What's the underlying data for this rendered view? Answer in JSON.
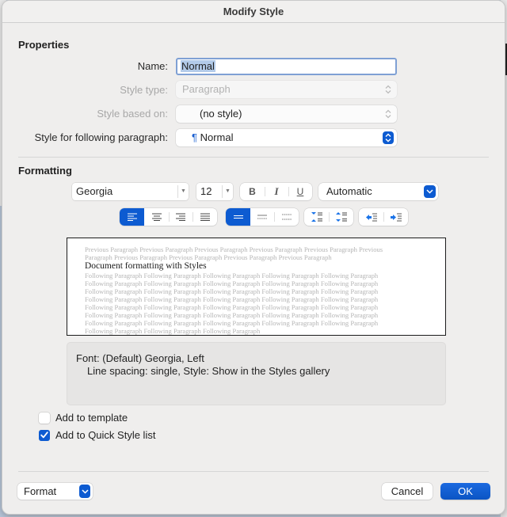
{
  "dialog": {
    "title": "Modify Style"
  },
  "properties": {
    "section_title": "Properties",
    "name_label": "Name:",
    "name_value": "Normal",
    "style_type_label": "Style type:",
    "style_type_value": "Paragraph",
    "based_on_label": "Style based on:",
    "based_on_value": "(no style)",
    "following_label": "Style for following paragraph:",
    "following_icon": "¶",
    "following_value": "Normal"
  },
  "formatting": {
    "section_title": "Formatting",
    "font_name": "Georgia",
    "font_size": "12",
    "bold_label": "B",
    "italic_label": "I",
    "underline_label": "U",
    "color_value": "Automatic",
    "alignment_buttons": [
      "align-left",
      "align-center",
      "align-right",
      "align-justify"
    ],
    "alignment_selected": "align-left",
    "spacing_buttons": [
      "single-spacing",
      "one-half-spacing",
      "double-spacing"
    ],
    "spacing_selected": "single-spacing",
    "paragraph_spacing_buttons": [
      "decrease-paragraph-spacing",
      "increase-paragraph-spacing"
    ],
    "indent_buttons": [
      "decrease-indent",
      "increase-indent"
    ]
  },
  "preview": {
    "previous_lines": [
      "Previous Paragraph Previous Paragraph Previous Paragraph Previous Paragraph Previous Paragraph Previous",
      "Paragraph Previous Paragraph Previous Paragraph Previous Paragraph Previous Paragraph"
    ],
    "sample_text": "Document formatting with Styles",
    "following_lines": [
      "Following Paragraph Following Paragraph Following Paragraph Following Paragraph Following Paragraph",
      "Following Paragraph Following Paragraph Following Paragraph Following Paragraph Following Paragraph",
      "Following Paragraph Following Paragraph Following Paragraph Following Paragraph Following Paragraph",
      "Following Paragraph Following Paragraph Following Paragraph Following Paragraph Following Paragraph",
      "Following Paragraph Following Paragraph Following Paragraph Following Paragraph Following Paragraph",
      "Following Paragraph Following Paragraph Following Paragraph Following Paragraph Following Paragraph",
      "Following Paragraph Following Paragraph Following Paragraph Following Paragraph Following Paragraph",
      "Following Paragraph Following Paragraph Following Paragraph"
    ]
  },
  "description": {
    "line1": "Font: (Default) Georgia, Left",
    "line2": "Line spacing:  single, Style: Show in the Styles gallery"
  },
  "options": {
    "add_to_template_label": "Add to template",
    "add_to_template_checked": false,
    "add_to_quick_style_label": "Add to Quick Style list",
    "add_to_quick_style_checked": true
  },
  "footer": {
    "format_label": "Format",
    "cancel_label": "Cancel",
    "ok_label": "OK"
  },
  "colors": {
    "accent": "#0d5bd1",
    "dialog_bg": "#efeeed",
    "selection": "#b3cbe9"
  }
}
